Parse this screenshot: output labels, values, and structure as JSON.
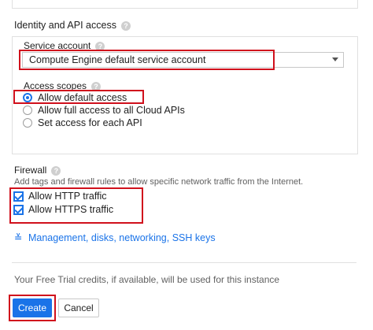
{
  "identity": {
    "title": "Identity and API access",
    "help_icon": "?",
    "service_account": {
      "label": "Service account",
      "value": "Compute Engine default service account"
    },
    "access_scopes": {
      "label": "Access scopes",
      "options": [
        {
          "label": "Allow default access",
          "selected": true
        },
        {
          "label": "Allow full access to all Cloud APIs",
          "selected": false
        },
        {
          "label": "Set access for each API",
          "selected": false
        }
      ]
    }
  },
  "firewall": {
    "title": "Firewall",
    "description": "Add tags and firewall rules to allow specific network traffic from the Internet.",
    "options": [
      {
        "label": "Allow HTTP traffic",
        "checked": true
      },
      {
        "label": "Allow HTTPS traffic",
        "checked": true
      }
    ]
  },
  "management_link": {
    "icon": "≚",
    "label": "Management, disks, networking, SSH keys"
  },
  "footer": {
    "trial_note": "Your Free Trial credits, if available, will be used for this instance",
    "create_label": "Create",
    "cancel_label": "Cancel"
  },
  "colors": {
    "accent": "#1a73e8",
    "highlight": "#d0101c"
  }
}
